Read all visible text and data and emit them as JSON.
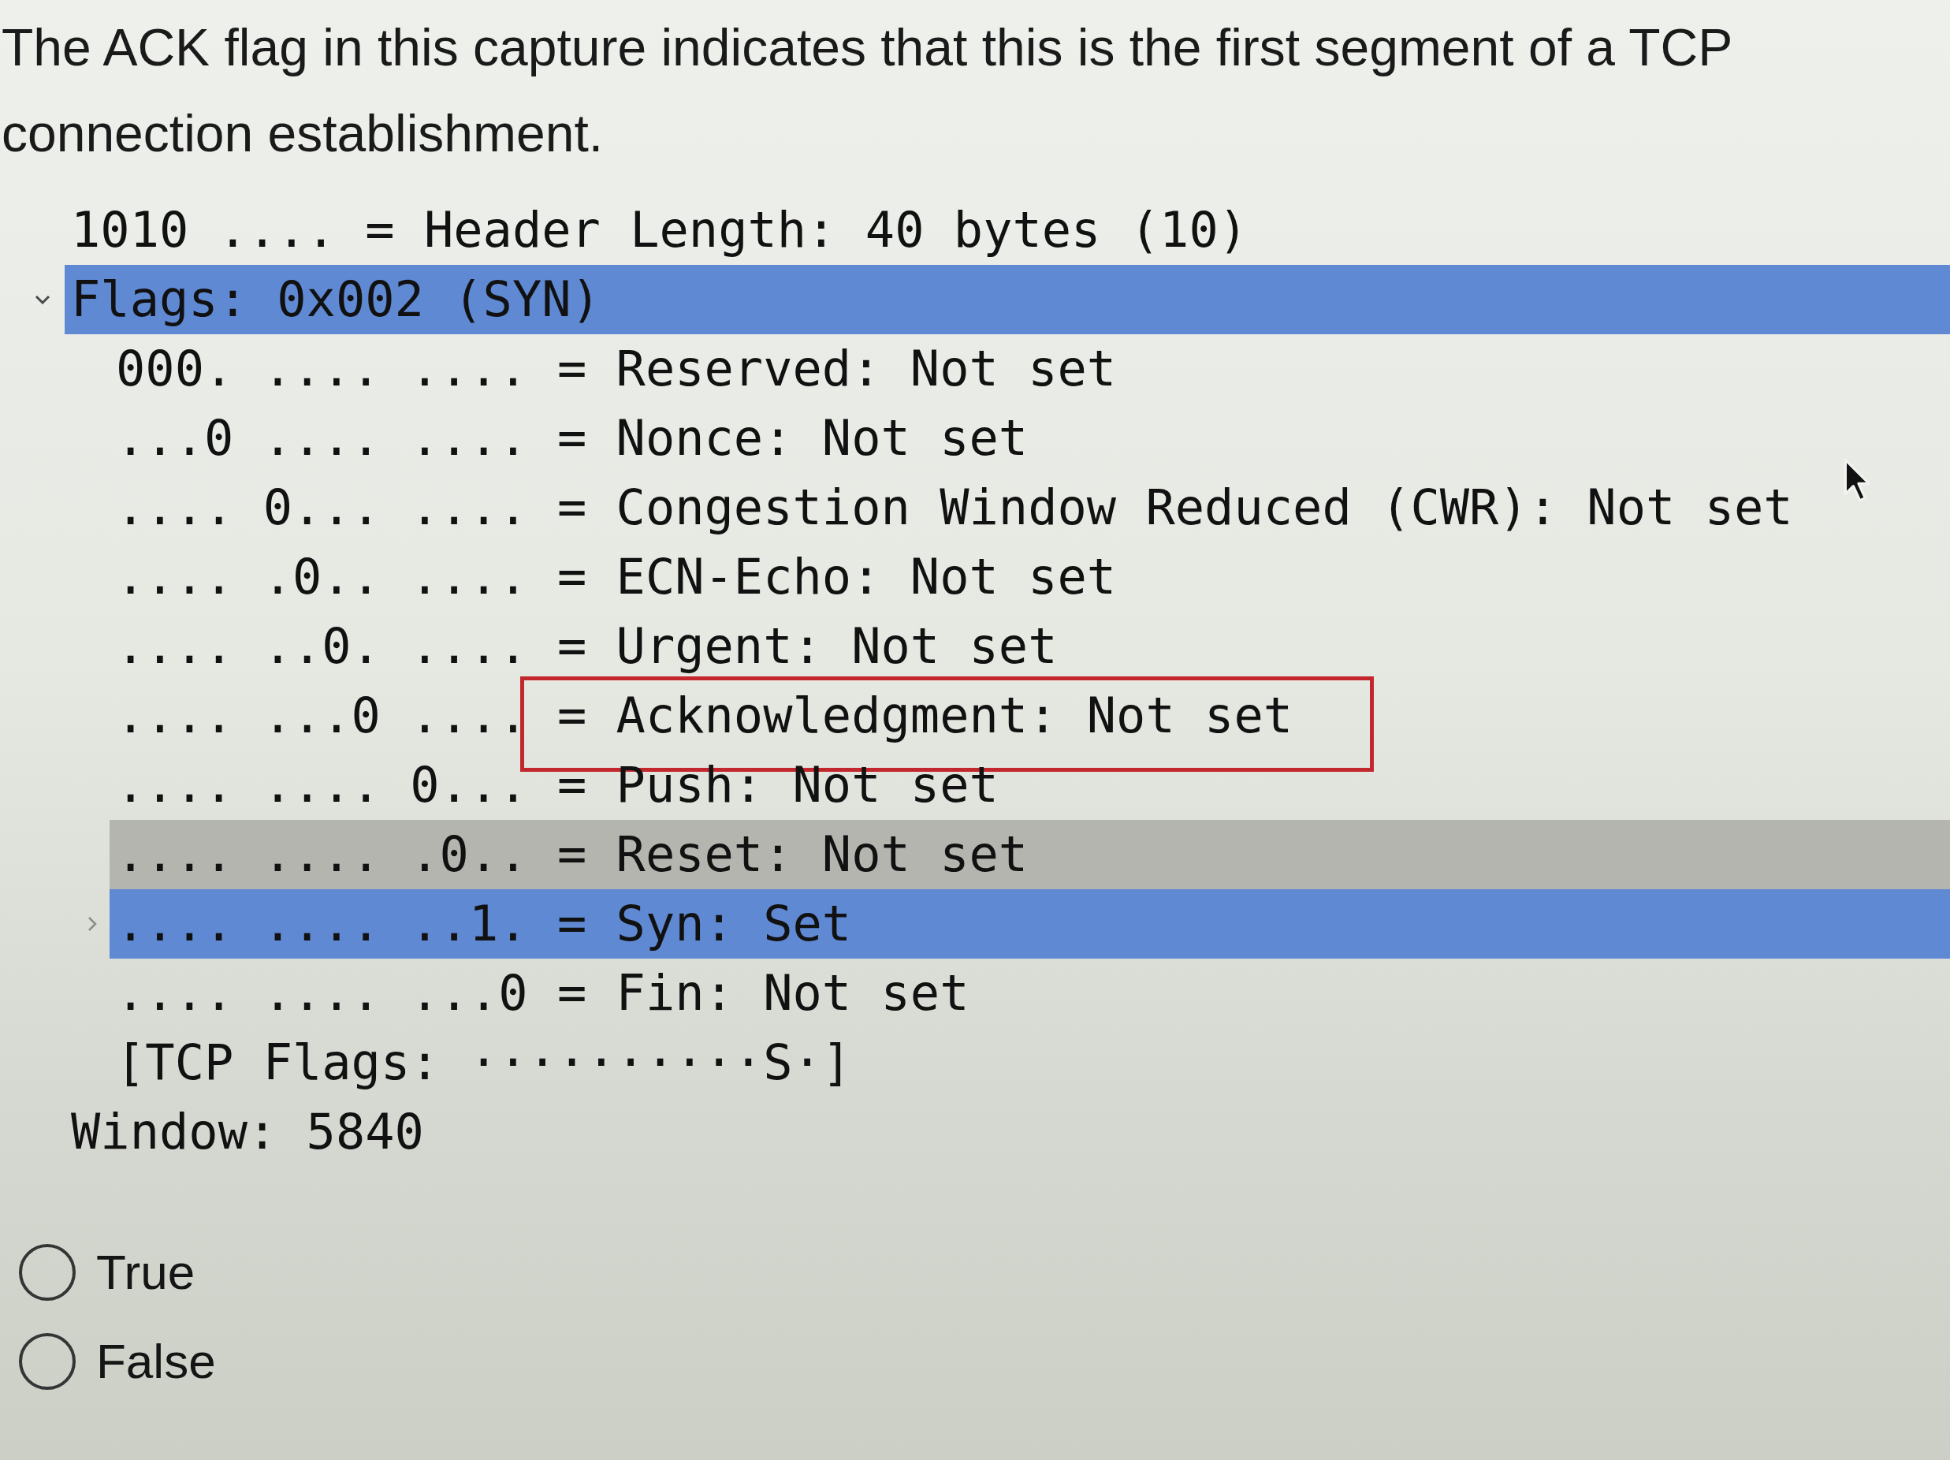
{
  "question": {
    "text": "The ACK flag in this capture indicates that this is the first segment of a TCP connection establishment."
  },
  "capture": {
    "rows": [
      {
        "bits": "1010 ....",
        "text": "= Header Length: 40 bytes (10)",
        "selected": false,
        "hovered": false,
        "boxed": false
      },
      {
        "text": "Flags: 0x002 (SYN)",
        "expanded": true,
        "selected": true,
        "hovered": false,
        "boxed": false,
        "children": [
          {
            "bits": "000. .... ....",
            "text": "= Reserved: Not set",
            "selected": false,
            "hovered": false,
            "boxed": false
          },
          {
            "bits": "...0 .... ....",
            "text": "= Nonce: Not set",
            "selected": false,
            "hovered": false,
            "boxed": false
          },
          {
            "bits": ".... 0... ....",
            "text": "= Congestion Window Reduced (CWR): Not set",
            "selected": false,
            "hovered": false,
            "boxed": false
          },
          {
            "bits": ".... .0.. ....",
            "text": "= ECN-Echo: Not set",
            "selected": false,
            "hovered": false,
            "boxed": false
          },
          {
            "bits": ".... ..0. ....",
            "text": "= Urgent: Not set",
            "selected": false,
            "hovered": false,
            "boxed": false
          },
          {
            "bits": ".... ...0 ....",
            "text": "= Acknowledgment: Not set",
            "selected": false,
            "hovered": false,
            "boxed": true
          },
          {
            "bits": ".... .... 0...",
            "text": "= Push: Not set",
            "selected": false,
            "hovered": false,
            "boxed": false
          },
          {
            "bits": ".... .... .0..",
            "text": "= Reset: Not set",
            "selected": false,
            "hovered": true,
            "boxed": false
          },
          {
            "bits": ".... .... ..1.",
            "text": "= Syn: Set",
            "expanded": false,
            "selected": true,
            "hovered": false,
            "boxed": false
          },
          {
            "bits": ".... .... ...0",
            "text": "= Fin: Not set",
            "selected": false,
            "hovered": false,
            "boxed": false
          },
          {
            "text": "[TCP Flags: ··········S·]",
            "selected": false,
            "hovered": false,
            "boxed": false
          }
        ]
      },
      {
        "text": "Window: 5840",
        "selected": false,
        "hovered": false,
        "boxed": false
      }
    ]
  },
  "options": [
    {
      "label": "True",
      "selected": false
    },
    {
      "label": "False",
      "selected": false
    }
  ]
}
